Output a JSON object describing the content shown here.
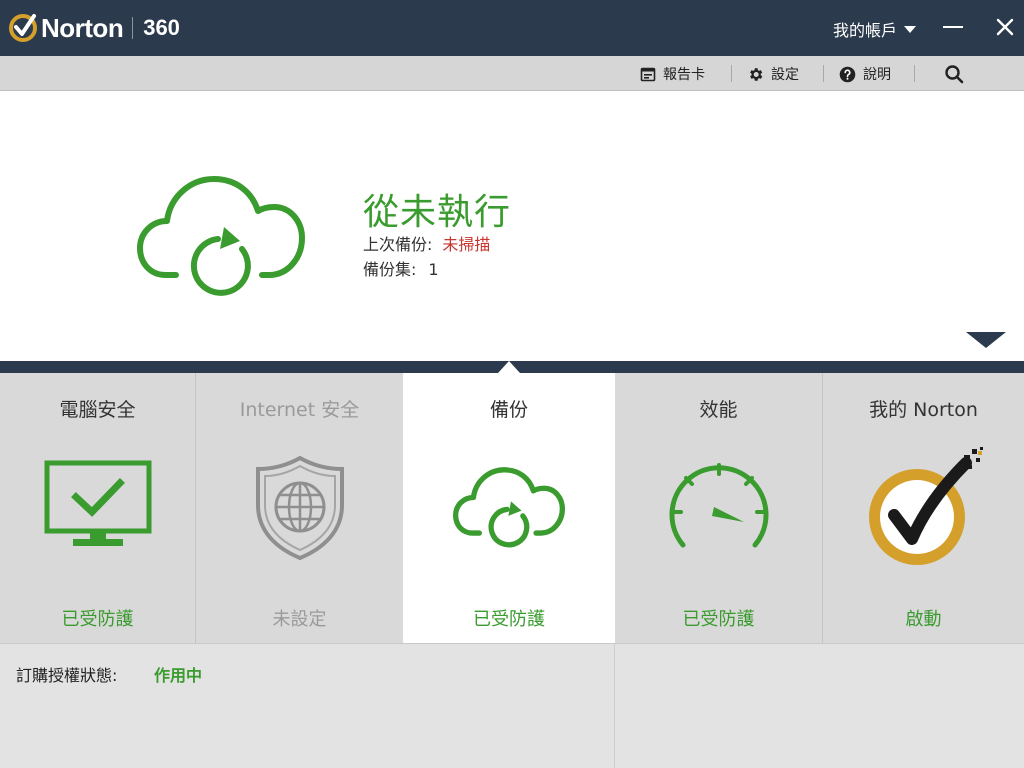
{
  "titlebar": {
    "brand": "Norton",
    "product": "360",
    "account_label": "我的帳戶",
    "icons": {
      "brand": "norton-check-badge-icon",
      "caret": "chevron-down-icon",
      "minimize": "minimize-icon",
      "close": "close-icon"
    }
  },
  "toolbar": {
    "report_card": "報告卡",
    "settings": "設定",
    "help": "說明",
    "icons": {
      "report_card": "calendar-icon",
      "settings": "gear-icon",
      "help": "question-circle-icon",
      "search": "search-icon"
    }
  },
  "hero": {
    "status_title": "從未執行",
    "last_backup_label": "上次備份:",
    "last_backup_value": "未掃描",
    "backup_sets_label": "備份集:",
    "backup_sets_value": "1"
  },
  "tiles": [
    {
      "title": "電腦安全",
      "status": "已受防護",
      "icon": "monitor-check-icon",
      "state": "on"
    },
    {
      "title": "Internet 安全",
      "status": "未設定",
      "icon": "globe-shield-icon",
      "state": "off"
    },
    {
      "title": "備份",
      "status": "已受防護",
      "icon": "cloud-sync-icon",
      "state": "active"
    },
    {
      "title": "效能",
      "status": "已受防護",
      "icon": "speedometer-icon",
      "state": "on"
    },
    {
      "title": "我的 Norton",
      "status": "啟動",
      "icon": "norton-seal-icon",
      "state": "on"
    }
  ],
  "footer": {
    "subscription_label": "訂購授權狀態:",
    "subscription_value": "作用中"
  },
  "colors": {
    "header_bg": "#2b3a4d",
    "accent_green": "#3a9b2e",
    "alert_red": "#c7362f",
    "norton_gold": "#d4a02b"
  }
}
